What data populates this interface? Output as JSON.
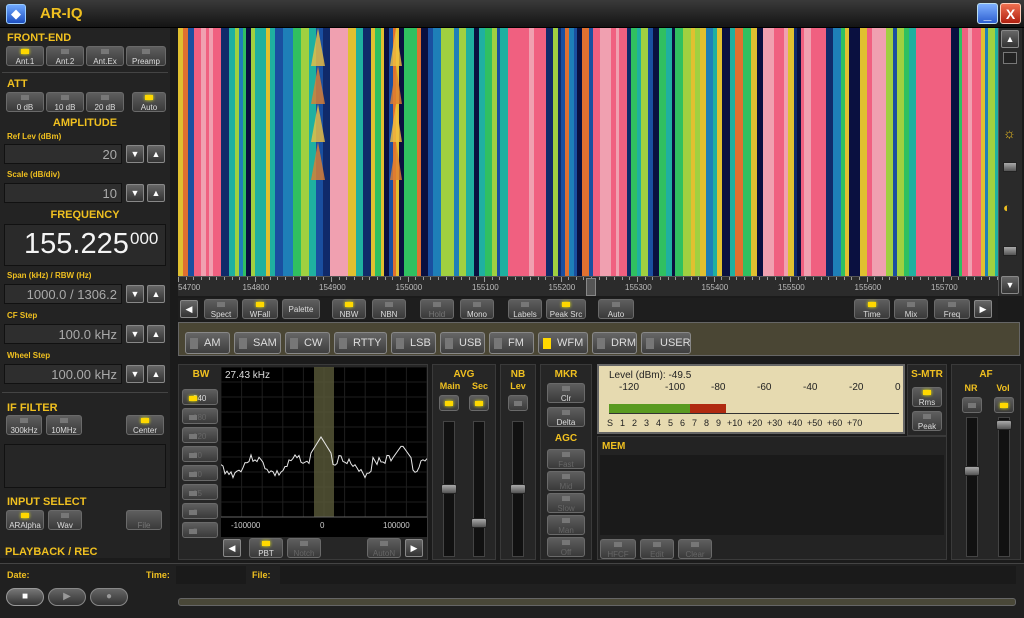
{
  "app": {
    "title": "AR-IQ",
    "icon": "app-logo-icon"
  },
  "window": {
    "minimize": "_",
    "close": "X"
  },
  "front_end": {
    "title": "FRONT-END",
    "buttons": [
      {
        "label": "Ant.1",
        "on": true
      },
      {
        "label": "Ant.2",
        "on": false
      },
      {
        "label": "Ant.Ex",
        "on": false
      },
      {
        "label": "Preamp",
        "on": false
      }
    ]
  },
  "att": {
    "title": "ATT",
    "buttons": [
      {
        "label": "0 dB",
        "on": false
      },
      {
        "label": "10 dB",
        "on": false
      },
      {
        "label": "20 dB",
        "on": false
      },
      {
        "label": "Auto",
        "on": true
      }
    ]
  },
  "amplitude": {
    "title": "AMPLITUDE",
    "ref_label": "Ref Lev (dBm)",
    "ref_value": "20",
    "scale_label": "Scale (dB/div)",
    "scale_value": "10"
  },
  "frequency": {
    "title": "FREQUENCY",
    "main": "155.225",
    "sub": "000",
    "span_label": "Span (kHz) / RBW (Hz)",
    "span_value": "1000.0 / 1306.2",
    "cfstep_label": "CF Step",
    "cfstep_value": "100.0 kHz",
    "wheel_label": "Wheel Step",
    "wheel_value": "100.00 kHz"
  },
  "if_filter": {
    "title": "IF FILTER",
    "buttons": [
      {
        "label": "300kHz",
        "on": false
      },
      {
        "label": "10MHz",
        "on": false
      },
      {
        "label": "Center",
        "on": true
      }
    ]
  },
  "input_select": {
    "title": "INPUT SELECT",
    "buttons": [
      {
        "label": "ARAlpha",
        "on": true
      },
      {
        "label": "Wav",
        "on": false
      },
      {
        "label": "File",
        "on": false
      }
    ]
  },
  "playback": {
    "title": "PLAYBACK / REC",
    "date_label": "Date:",
    "time_label": "Time:",
    "file_label": "File:"
  },
  "ruler": {
    "labels": [
      "54700",
      "154800",
      "154900",
      "155000",
      "155100",
      "155200",
      "155300",
      "155400",
      "155500",
      "155600",
      "155700"
    ]
  },
  "waterfall_toolbar": {
    "left": [
      {
        "label": "Spect",
        "on": false
      },
      {
        "label": "WFall",
        "on": true
      },
      {
        "label": "Palette",
        "on": false
      },
      {
        "label": "NBW",
        "on": true
      },
      {
        "label": "NBN",
        "on": false
      },
      {
        "label": "Hold",
        "on": false
      },
      {
        "label": "Mono",
        "on": false
      },
      {
        "label": "Labels",
        "on": false
      },
      {
        "label": "Peak Src",
        "on": true
      },
      {
        "label": "Auto",
        "on": false
      }
    ],
    "right": [
      {
        "label": "Time",
        "on": true
      },
      {
        "label": "Mix",
        "on": false
      },
      {
        "label": "Freq",
        "on": false
      }
    ]
  },
  "modes": [
    {
      "label": "AM",
      "on": false
    },
    {
      "label": "SAM",
      "on": false
    },
    {
      "label": "CW",
      "on": false
    },
    {
      "label": "RTTY",
      "on": false
    },
    {
      "label": "LSB",
      "on": false
    },
    {
      "label": "USB",
      "on": false
    },
    {
      "label": "FM",
      "on": false
    },
    {
      "label": "WFM",
      "on": true
    },
    {
      "label": "DRM",
      "on": false
    },
    {
      "label": "USER",
      "on": false
    }
  ],
  "bw": {
    "title": "BW",
    "buttons": [
      "240",
      "180",
      "120",
      "60",
      "30",
      "15",
      "6",
      "3"
    ],
    "readout": "27.43 kHz",
    "axis": [
      "-100000",
      "0",
      "100000"
    ],
    "bottom_buttons": [
      {
        "label": "PBT",
        "on": true
      },
      {
        "label": "Notch",
        "on": false
      },
      {
        "label": "AutoN",
        "on": false
      }
    ]
  },
  "avg": {
    "title": "AVG",
    "main": "Main",
    "sec": "Sec"
  },
  "nb": {
    "title": "NB",
    "lev": "Lev"
  },
  "mkr": {
    "title": "MKR",
    "buttons": [
      "Clr",
      "Delta"
    ]
  },
  "agc": {
    "title": "AGC",
    "buttons": [
      "Fast",
      "Mid",
      "Slow",
      "Man",
      "Off"
    ]
  },
  "level": {
    "readout": "Level (dBm): -49.5",
    "scale_top": [
      "-120",
      "-100",
      "-80",
      "-60",
      "-40",
      "-20",
      "0"
    ],
    "scale_bottom": [
      "S",
      "1",
      "2",
      "3",
      "4",
      "5",
      "6",
      "7",
      "8",
      "9",
      "+10",
      "+20",
      "+30",
      "+40",
      "+50",
      "+60",
      "+70"
    ],
    "value_dbm": -49.5
  },
  "smtr": {
    "title": "S-MTR",
    "buttons": [
      {
        "label": "Rms",
        "on": true
      },
      {
        "label": "Peak",
        "on": false
      }
    ]
  },
  "af": {
    "title": "AF",
    "nr": "NR",
    "vol": "Vol"
  },
  "mem": {
    "title": "MEM",
    "buttons": [
      "HFCF",
      "Edit",
      "Clear"
    ]
  },
  "colors": {
    "accent": "#f0c020",
    "led_on": "#ffd800",
    "meter_green": "#5a9a20",
    "meter_red": "#b02a10"
  }
}
